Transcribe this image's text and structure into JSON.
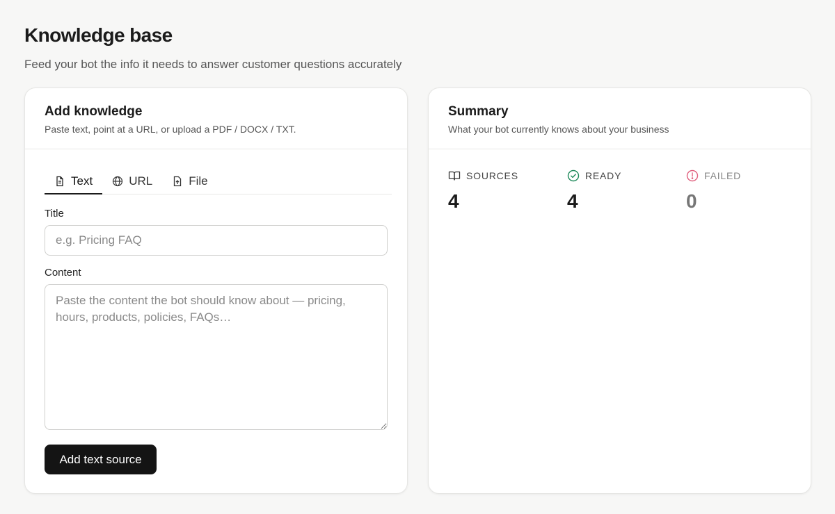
{
  "page": {
    "title": "Knowledge base",
    "subtitle": "Feed your bot the info it needs to answer customer questions accurately"
  },
  "add_card": {
    "title": "Add knowledge",
    "description": "Paste text, point at a URL, or upload a PDF / DOCX / TXT.",
    "tabs": [
      {
        "label": "Text",
        "icon": "document-icon",
        "active": true
      },
      {
        "label": "URL",
        "icon": "globe-icon",
        "active": false
      },
      {
        "label": "File",
        "icon": "file-upload-icon",
        "active": false
      }
    ],
    "title_field": {
      "label": "Title",
      "value": "",
      "placeholder": "e.g. Pricing FAQ"
    },
    "content_field": {
      "label": "Content",
      "value": "",
      "placeholder": "Paste the content the bot should know about — pricing, hours, products, policies, FAQs…"
    },
    "submit_label": "Add text source"
  },
  "summary_card": {
    "title": "Summary",
    "description": "What your bot currently knows about your business",
    "stats": [
      {
        "label": "SOURCES",
        "value": "4",
        "icon": "book-icon"
      },
      {
        "label": "READY",
        "value": "4",
        "icon": "check-circle-icon",
        "color": "#1f8a5b"
      },
      {
        "label": "FAILED",
        "value": "0",
        "icon": "alert-circle-icon",
        "color": "#e0607e"
      }
    ]
  },
  "colors": {
    "background": "#f7f7f6",
    "primary_button": "#141414",
    "ready": "#1f8a5b",
    "failed": "#e0607e"
  }
}
